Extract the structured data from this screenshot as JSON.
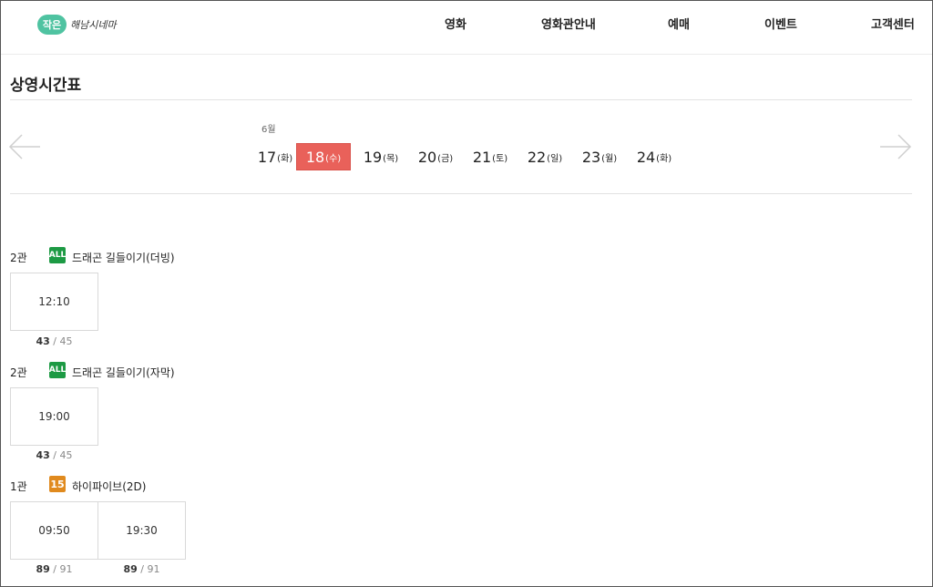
{
  "header": {
    "logo_badge": "작은",
    "logo_text": "해남시네마",
    "nav": [
      "영화",
      "영화관안내",
      "예매",
      "이벤트",
      "고객센터"
    ]
  },
  "page_title": "상영시간표",
  "calendar": {
    "month": "6월",
    "days": [
      {
        "num": "17",
        "dow": "(화)"
      },
      {
        "num": "18",
        "dow": "(수)"
      },
      {
        "num": "19",
        "dow": "(목)"
      },
      {
        "num": "20",
        "dow": "(금)"
      },
      {
        "num": "21",
        "dow": "(토)"
      },
      {
        "num": "22",
        "dow": "(일)"
      },
      {
        "num": "23",
        "dow": "(월)"
      },
      {
        "num": "24",
        "dow": "(화)"
      }
    ],
    "selected": "18"
  },
  "schedule": [
    {
      "hall": "2관",
      "rating": "ALL",
      "title": "드래곤 길들이기(더빙)",
      "times": [
        {
          "time": "12:10",
          "remaining": "43",
          "total": "/ 45"
        }
      ]
    },
    {
      "hall": "2관",
      "rating": "ALL",
      "title": "드래곤 길들이기(자막)",
      "times": [
        {
          "time": "19:00",
          "remaining": "43",
          "total": "/ 45"
        }
      ]
    },
    {
      "hall": "1관",
      "rating": "15",
      "title": "하이파이브(2D)",
      "times": [
        {
          "time": "09:50",
          "remaining": "89",
          "total": "/ 91"
        },
        {
          "time": "19:30",
          "remaining": "89",
          "total": "/ 91"
        }
      ]
    }
  ],
  "colors": {
    "accent": "#e9615a",
    "rating_all": "#1d9a44",
    "rating_15": "#e08a1e",
    "logo": "#4fc3a1"
  }
}
